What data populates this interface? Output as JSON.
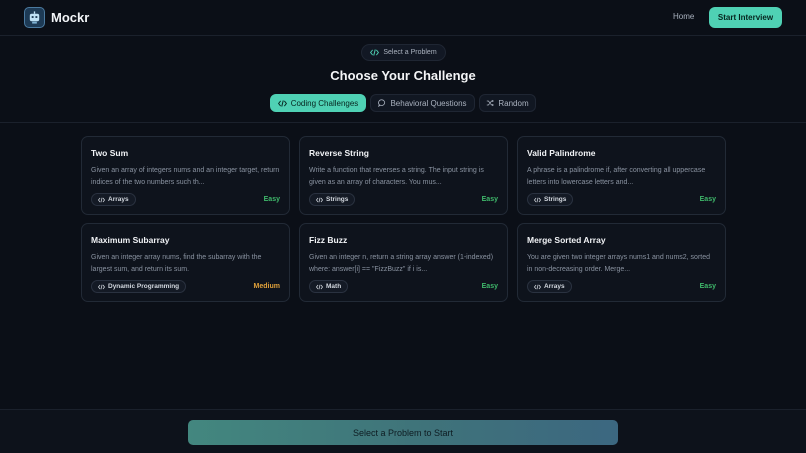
{
  "header": {
    "brand": "Mockr",
    "nav_home": "Home",
    "start_button": "Start Interview"
  },
  "hero": {
    "pill": "Select a Problem",
    "title": "Choose Your Challenge",
    "tabs": [
      {
        "label": "Coding Challenges",
        "icon": "code-icon",
        "active": true
      },
      {
        "label": "Behavioral Questions",
        "icon": "chat-bubble-icon",
        "active": false
      },
      {
        "label": "Random",
        "icon": "shuffle-icon",
        "active": false
      }
    ]
  },
  "problems": [
    {
      "title": "Two Sum",
      "desc": "Given an array of integers nums and an integer target, return indices of the two numbers such th...",
      "tag": "Arrays",
      "difficulty": "Easy"
    },
    {
      "title": "Reverse String",
      "desc": "Write a function that reverses a string. The input string is given as an array of characters. You mus...",
      "tag": "Strings",
      "difficulty": "Easy"
    },
    {
      "title": "Valid Palindrome",
      "desc": "A phrase is a palindrome if, after converting all uppercase letters into lowercase letters and...",
      "tag": "Strings",
      "difficulty": "Easy"
    },
    {
      "title": "Maximum Subarray",
      "desc": "Given an integer array nums, find the subarray with the largest sum, and return its sum.",
      "tag": "Dynamic Programming",
      "difficulty": "Medium"
    },
    {
      "title": "Fizz Buzz",
      "desc": "Given an integer n, return a string array answer (1-indexed) where: answer[i] == \"FizzBuzz\" if i is...",
      "tag": "Math",
      "difficulty": "Easy"
    },
    {
      "title": "Merge Sorted Array",
      "desc": "You are given two integer arrays nums1 and nums2, sorted in non-decreasing order. Merge...",
      "tag": "Arrays",
      "difficulty": "Easy"
    }
  ],
  "footer": {
    "button": "Select a Problem to Start"
  },
  "colors": {
    "accent": "#4fd1b4",
    "easy": "#3fb96b",
    "medium": "#e0a13a"
  }
}
